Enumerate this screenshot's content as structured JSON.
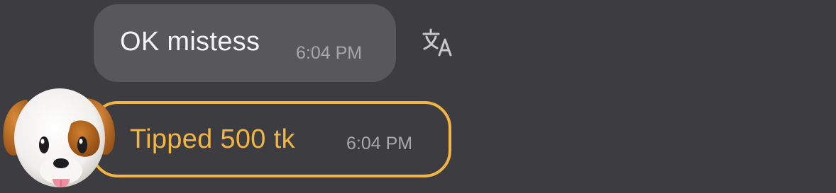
{
  "messages": [
    {
      "type": "received",
      "text": "OK mistess",
      "time": "6:04 PM"
    },
    {
      "type": "tip",
      "text": "Tipped 500 tk",
      "time": "6:04 PM"
    }
  ],
  "icons": {
    "translate": "translate-icon",
    "avatar": "dog-emoji-avatar"
  },
  "colors": {
    "background": "#3d3d41",
    "received_bubble": "#58585c",
    "tip_accent": "#f2b442",
    "timestamp": "#a8a8ac"
  }
}
